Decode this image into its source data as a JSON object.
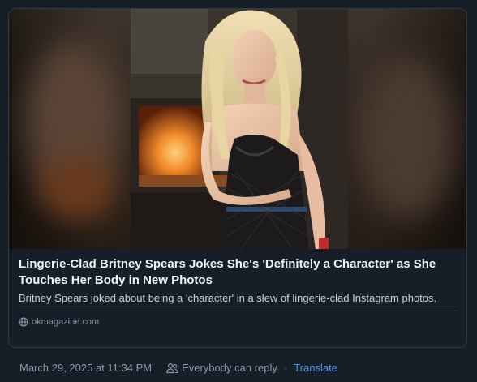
{
  "link_card": {
    "title": "Lingerie-Clad Britney Spears Jokes She's 'Definitely a Character' as She Touches Her Body in New Photos",
    "description": "Britney Spears joked about being a 'character' in a slew of lingerie-clad Instagram photos.",
    "domain": "okmagazine.com",
    "image_icon": "photo-thumbnail",
    "domain_icon": "globe-icon"
  },
  "post_meta": {
    "timestamp": "March 29, 2025 at 11:34 PM",
    "reply_setting": "Everybody can reply",
    "separator": "·",
    "translate_label": "Translate",
    "reply_icon": "people-icon"
  },
  "colors": {
    "background": "#161e27",
    "border": "#2e3a48",
    "title": "#eef3f8",
    "description": "#c9d2dc",
    "muted": "#8b98a7",
    "link": "#4c97ee"
  }
}
